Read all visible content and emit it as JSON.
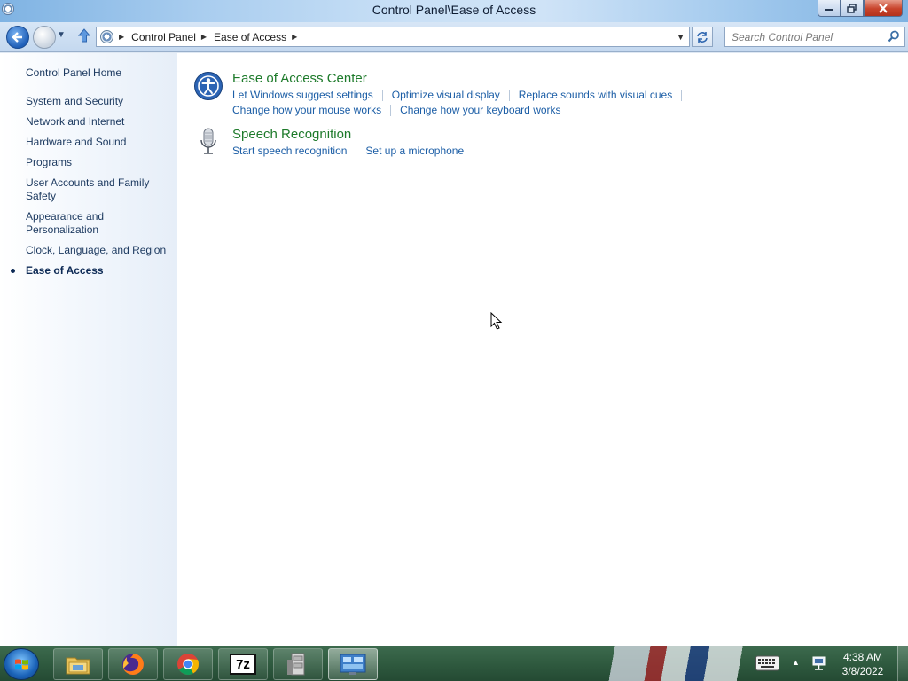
{
  "window": {
    "title": "Control Panel\\Ease of Access",
    "icon": "control-panel-icon"
  },
  "nav": {
    "breadcrumb": [
      "Control Panel",
      "Ease of Access"
    ],
    "search_placeholder": "Search Control Panel"
  },
  "sidebar": {
    "home": "Control Panel Home",
    "items": [
      {
        "label": "System and Security"
      },
      {
        "label": "Network and Internet"
      },
      {
        "label": "Hardware and Sound"
      },
      {
        "label": "Programs"
      },
      {
        "label": "User Accounts and Family Safety"
      },
      {
        "label": "Appearance and Personalization"
      },
      {
        "label": "Clock, Language, and Region"
      },
      {
        "label": "Ease of Access",
        "current": true
      }
    ]
  },
  "categories": [
    {
      "icon": "ease-of-access-icon",
      "title": "Ease of Access Center",
      "links": [
        "Let Windows suggest settings",
        "Optimize visual display",
        "Replace sounds with visual cues",
        "Change how your mouse works",
        "Change how your keyboard works"
      ]
    },
    {
      "icon": "microphone-icon",
      "title": "Speech Recognition",
      "links": [
        "Start speech recognition",
        "Set up a microphone"
      ]
    }
  ],
  "taskbar": {
    "apps": [
      "windows-explorer-icon",
      "firefox-icon",
      "chrome-icon",
      "7zip-icon",
      "file-cabinet-icon",
      "control-panel-icon"
    ],
    "active_app": "control-panel-icon",
    "clock": {
      "time": "4:38 AM",
      "date": "3/8/2022"
    },
    "label_7z": "7z"
  },
  "colors": {
    "heading_green": "#1d7a2a",
    "link_blue": "#1c5ea6",
    "sidebar_text": "#1e3b61"
  }
}
